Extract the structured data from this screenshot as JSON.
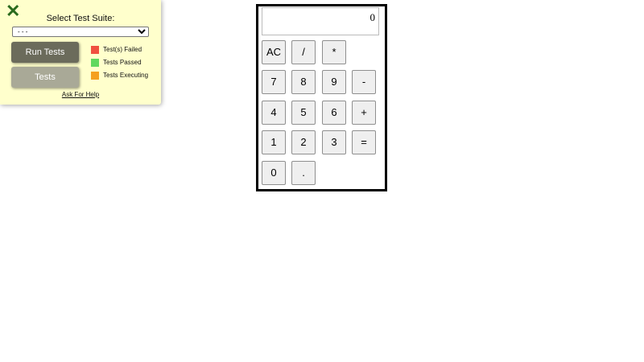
{
  "panel": {
    "close_icon": "close-x-icon",
    "title": "Select Test Suite:",
    "select_value": "- - -",
    "run_button": "Run Tests",
    "tests_button": "Tests",
    "legend": [
      {
        "label": "Test(s) Failed",
        "color": "#f05040"
      },
      {
        "label": "Tests Passed",
        "color": "#5fd85f"
      },
      {
        "label": "Tests Executing",
        "color": "#f5a020"
      }
    ],
    "help_link": "Ask For Help"
  },
  "calculator": {
    "display": "0",
    "keys": {
      "ac": "AC",
      "divide": "/",
      "multiply": "*",
      "seven": "7",
      "eight": "8",
      "nine": "9",
      "minus": "-",
      "four": "4",
      "five": "5",
      "six": "6",
      "plus": "+",
      "one": "1",
      "two": "2",
      "three": "3",
      "equals": "=",
      "zero": "0",
      "decimal": "."
    }
  }
}
